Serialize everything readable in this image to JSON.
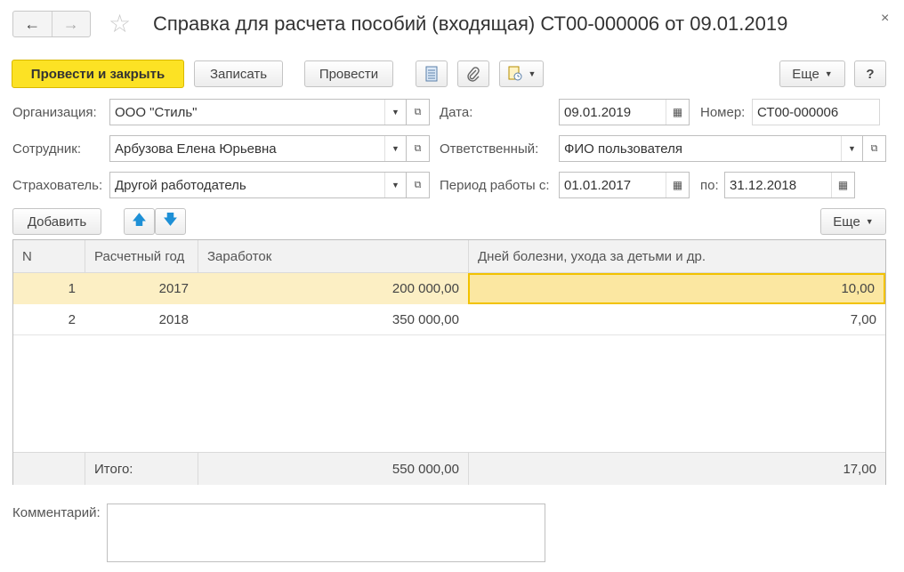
{
  "window": {
    "title": "Справка для расчета пособий (входящая) СТ00-000006 от 09.01.2019",
    "back_glyph": "←",
    "forward_glyph": "→",
    "favorite_glyph": "☆",
    "close_glyph": "×"
  },
  "toolbar": {
    "post_close_label": "Провести и закрыть",
    "save_label": "Записать",
    "post_label": "Провести",
    "more_label": "Еще",
    "help_label": "?"
  },
  "form": {
    "organization_label": "Организация:",
    "organization_value": "ООО \"Стиль\"",
    "employee_label": "Сотрудник:",
    "employee_value": "Арбузова Елена Юрьевна",
    "insurer_label": "Страхователь:",
    "insurer_value": "Другой работодатель",
    "date_label": "Дата:",
    "date_value": "09.01.2019",
    "number_label": "Номер:",
    "number_value": "СТ00-000006",
    "responsible_label": "Ответственный:",
    "responsible_value": "ФИО пользователя",
    "period_from_label": "Период работы с:",
    "period_from_value": "01.01.2017",
    "period_to_label": "по:",
    "period_to_value": "31.12.2018"
  },
  "table_toolbar": {
    "add_label": "Добавить",
    "up_glyph": "🡅",
    "down_glyph": "🡇",
    "more_label": "Еще"
  },
  "table": {
    "columns": [
      "N",
      "Расчетный год",
      "Заработок",
      "Дней болезни, ухода за детьми и др."
    ],
    "rows": [
      {
        "n": "1",
        "year": "2017",
        "earnings": "200 000,00",
        "days": "10,00"
      },
      {
        "n": "2",
        "year": "2018",
        "earnings": "350 000,00",
        "days": "7,00"
      }
    ],
    "footer": {
      "label": "Итого:",
      "earnings": "550 000,00",
      "days": "17,00"
    }
  },
  "comment": {
    "label": "Комментарий:",
    "value": ""
  },
  "colors": {
    "primary_button": "#fce224",
    "selected_row": "#fcefc4",
    "selected_cell_border": "#f2c200"
  }
}
